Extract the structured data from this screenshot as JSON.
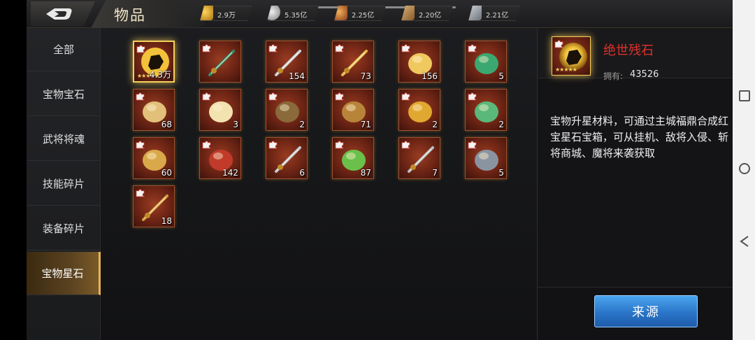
{
  "header": {
    "title": "物品",
    "resources": [
      {
        "icon": "gold-ingot-icon",
        "value": "2.9万",
        "color": "#d9a21b"
      },
      {
        "icon": "silver-coin-icon",
        "value": "5.35亿",
        "color": "#c9c9c9"
      },
      {
        "icon": "food-bundle-icon",
        "value": "2.25亿",
        "color": "#c77d2e"
      },
      {
        "icon": "wood-log-icon",
        "value": "2.20亿",
        "color": "#b88a4a"
      },
      {
        "icon": "iron-ingot-icon",
        "value": "2.21亿",
        "color": "#9aa0a8"
      }
    ]
  },
  "sidebar": {
    "tabs": [
      {
        "label": "全部",
        "active": false
      },
      {
        "label": "宝物宝石",
        "active": false
      },
      {
        "label": "武将将魂",
        "active": false
      },
      {
        "label": "技能碎片",
        "active": false
      },
      {
        "label": "装备碎片",
        "active": false
      },
      {
        "label": "宝物星石",
        "active": true
      }
    ]
  },
  "items": [
    {
      "name": "stone-icon",
      "qty": "4.3万",
      "selected": true
    },
    {
      "name": "halberd-icon",
      "qty": ""
    },
    {
      "name": "long-sword-icon",
      "qty": "154"
    },
    {
      "name": "golden-spear-icon",
      "qty": "73"
    },
    {
      "name": "gold-ornament-icon",
      "qty": "156"
    },
    {
      "name": "mace-icon",
      "qty": "5"
    },
    {
      "name": "scroll-icon",
      "qty": "68"
    },
    {
      "name": "bamboo-scroll-icon",
      "qty": "3"
    },
    {
      "name": "armor-icon",
      "qty": "2"
    },
    {
      "name": "bronze-beast-icon",
      "qty": "71"
    },
    {
      "name": "golden-vessel-icon",
      "qty": "2"
    },
    {
      "name": "jade-pendant-icon",
      "qty": "2"
    },
    {
      "name": "crossbow-icon",
      "qty": "60"
    },
    {
      "name": "war-horse-icon",
      "qty": "142"
    },
    {
      "name": "dagger-icon",
      "qty": "6"
    },
    {
      "name": "gourd-icon",
      "qty": "87"
    },
    {
      "name": "short-sword-icon",
      "qty": "7"
    },
    {
      "name": "hammer-icon",
      "qty": "5"
    },
    {
      "name": "spear-icon",
      "qty": "18"
    }
  ],
  "detail": {
    "name": "绝世残石",
    "own_label": "拥有:",
    "own_value": "43526",
    "description": "宝物升星材料，可通过主城福鼎合成红宝星石宝箱，可从挂机、敌将入侵、斩将商城、魔将来袭获取",
    "source_button": "来源",
    "name_color": "#e0312b"
  }
}
